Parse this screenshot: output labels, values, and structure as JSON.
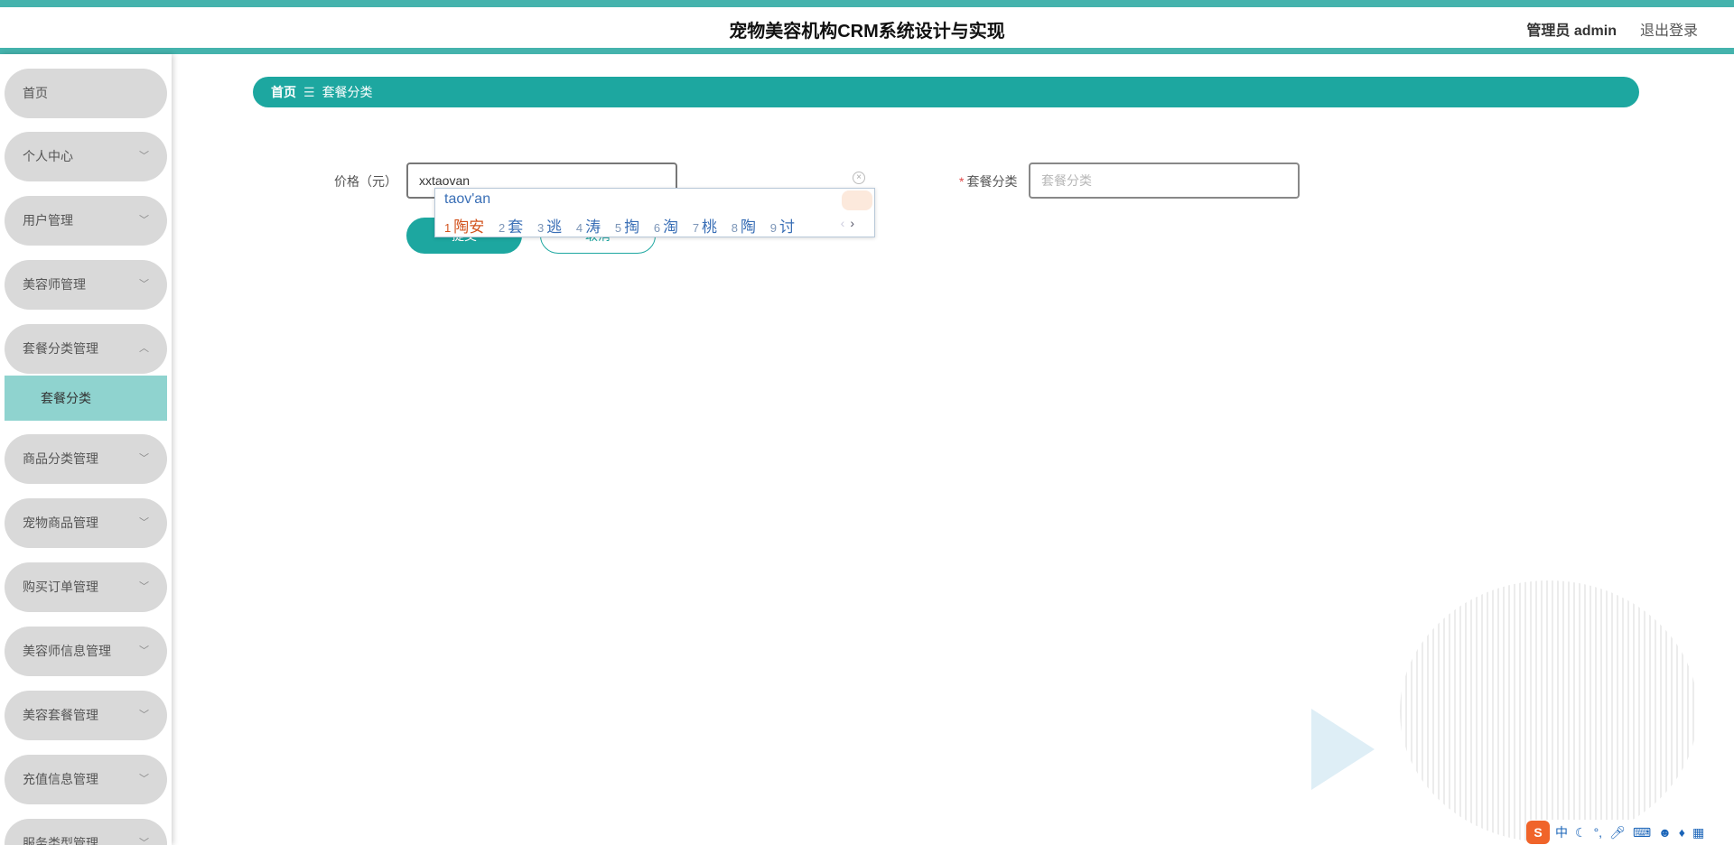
{
  "header": {
    "title": "宠物美容机构CRM系统设计与实现",
    "user_label": "管理员 admin",
    "logout_label": "退出登录"
  },
  "sidebar": {
    "items": [
      {
        "label": "首页",
        "has_chevron": false
      },
      {
        "label": "个人中心",
        "chevron": "﹀"
      },
      {
        "label": "用户管理",
        "chevron": "﹀"
      },
      {
        "label": "美容师管理",
        "chevron": "﹀"
      },
      {
        "label": "套餐分类管理",
        "chevron": "︿"
      },
      {
        "label": "商品分类管理",
        "chevron": "﹀"
      },
      {
        "label": "宠物商品管理",
        "chevron": "﹀"
      },
      {
        "label": "购买订单管理",
        "chevron": "﹀"
      },
      {
        "label": "美容师信息管理",
        "chevron": "﹀"
      },
      {
        "label": "美容套餐管理",
        "chevron": "﹀"
      },
      {
        "label": "充值信息管理",
        "chevron": "﹀"
      },
      {
        "label": "服务类型管理",
        "chevron": "﹀"
      }
    ],
    "active_sub": "套餐分类"
  },
  "breadcrumb": {
    "home": "首页",
    "separator": "☰",
    "current": "套餐分类"
  },
  "form": {
    "price_label": "价格（元）",
    "price_value": "xxtaovan",
    "category_required_mark": "*",
    "category_label": "套餐分类",
    "category_placeholder": "套餐分类",
    "submit_label": "提交",
    "cancel_label": "取消"
  },
  "ime": {
    "composition": "taov'an",
    "candidates": [
      {
        "num": "1",
        "text": "陶安"
      },
      {
        "num": "2",
        "text": "套"
      },
      {
        "num": "3",
        "text": "逃"
      },
      {
        "num": "4",
        "text": "涛"
      },
      {
        "num": "5",
        "text": "掏"
      },
      {
        "num": "6",
        "text": "淘"
      },
      {
        "num": "7",
        "text": "桃"
      },
      {
        "num": "8",
        "text": "陶"
      },
      {
        "num": "9",
        "text": "讨"
      }
    ],
    "prev": "‹",
    "next": "›"
  },
  "tray": {
    "logo": "S",
    "lang": "中"
  },
  "colors": {
    "accent": "#1da7a0",
    "header_border": "#45b3ad",
    "active_sub_bg": "#8fd3cf",
    "menu_bg": "#d9d9d9"
  }
}
